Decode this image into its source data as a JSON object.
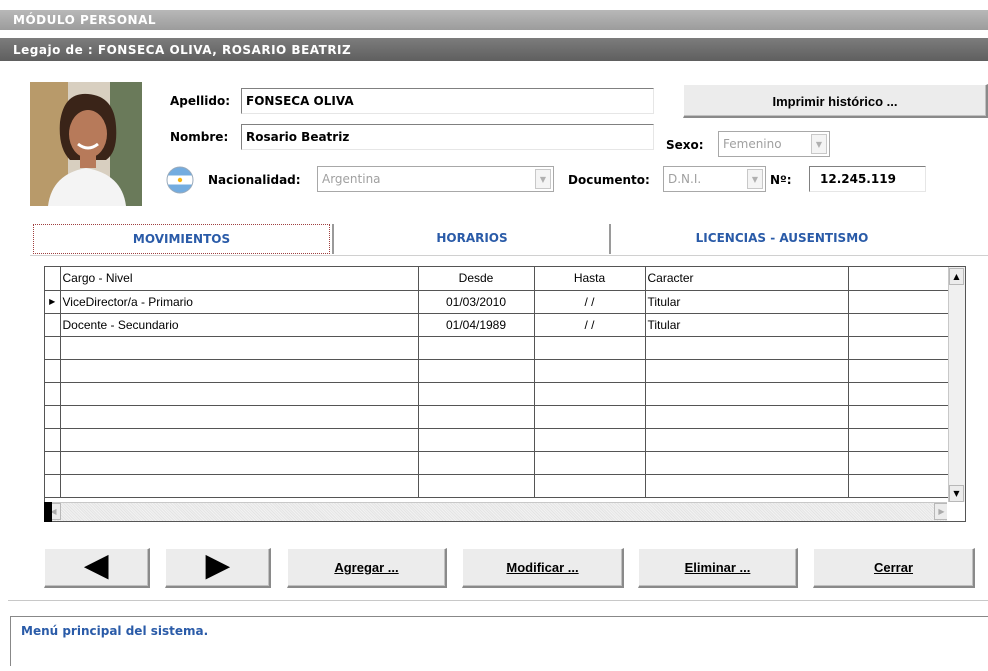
{
  "module_title": "MÓDULO PERSONAL",
  "record_title": "Legajo de : FONSECA OLIVA, ROSARIO BEATRIZ",
  "form": {
    "apellido_label": "Apellido:",
    "apellido_value": "FONSECA OLIVA",
    "nombre_label": "Nombre:",
    "nombre_value": "Rosario Beatriz",
    "nacionalidad_label": "Nacionalidad:",
    "nacionalidad_value": "Argentina",
    "sexo_label": "Sexo:",
    "sexo_value": "Femenino",
    "documento_label": "Documento:",
    "documento_value": "D.N.I.",
    "numero_label": "Nº:",
    "numero_value": "12.245.119",
    "print_history_button": "Imprimir histórico ..."
  },
  "tabs": [
    {
      "label": "MOVIMIENTOS"
    },
    {
      "label": "HORARIOS"
    },
    {
      "label": "LICENCIAS - AUSENTISMO"
    }
  ],
  "grid": {
    "columns": [
      "Cargo - Nivel",
      "Desde",
      "Hasta",
      "Caracter",
      ""
    ],
    "rows": [
      {
        "cargo": "ViceDirector/a - Primario",
        "desde": "01/03/2010",
        "hasta": "/ /",
        "caracter": "Titular"
      },
      {
        "cargo": "Docente - Secundario",
        "desde": "01/04/1989",
        "hasta": "/ /",
        "caracter": "Titular"
      }
    ]
  },
  "buttons": {
    "prev_glyph": "◀",
    "next_glyph": "▶",
    "add": "Agregar ...",
    "modify": "Modificar ...",
    "delete": "Eliminar ...",
    "close": "Cerrar"
  },
  "status_text": "Menú principal del sistema.",
  "icons": {
    "flag": "argentina-flag-icon",
    "prev": "arrow-left-icon",
    "next": "arrow-right-icon",
    "row_pointer": "row-pointer-icon"
  },
  "colors": {
    "tab_text": "#2a5ba8",
    "header_bar": "#6a6a6a",
    "status_text": "#2a5ba8"
  }
}
